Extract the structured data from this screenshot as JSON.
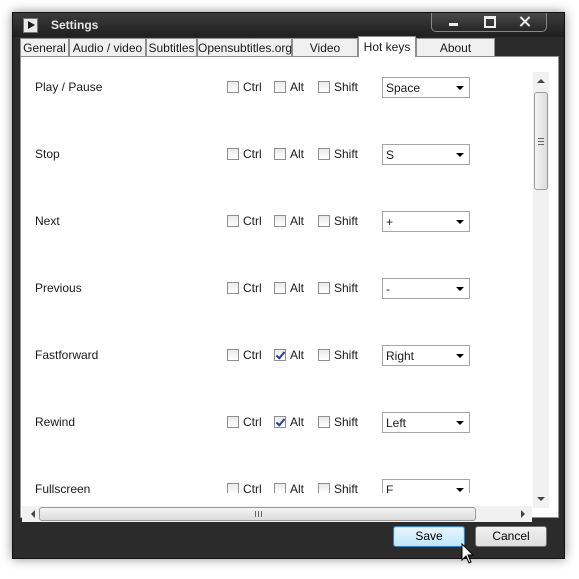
{
  "window": {
    "title": "Settings"
  },
  "tabs": [
    {
      "label": "General"
    },
    {
      "label": "Audio / video"
    },
    {
      "label": "Subtitles"
    },
    {
      "label": "Opensubtitles.org"
    },
    {
      "label": "Video library"
    },
    {
      "label": "Hot keys",
      "active": true
    },
    {
      "label": "About Kantaris"
    }
  ],
  "modifier_labels": {
    "ctrl": "Ctrl",
    "alt": "Alt",
    "shift": "Shift"
  },
  "hotkeys": [
    {
      "action": "Play / Pause",
      "ctrl": false,
      "alt": false,
      "shift": false,
      "key": "Space"
    },
    {
      "action": "Stop",
      "ctrl": false,
      "alt": false,
      "shift": false,
      "key": "S"
    },
    {
      "action": "Next",
      "ctrl": false,
      "alt": false,
      "shift": false,
      "key": "+"
    },
    {
      "action": "Previous",
      "ctrl": false,
      "alt": false,
      "shift": false,
      "key": "-"
    },
    {
      "action": "Fastforward",
      "ctrl": false,
      "alt": true,
      "shift": false,
      "key": "Right"
    },
    {
      "action": "Rewind",
      "ctrl": false,
      "alt": true,
      "shift": false,
      "key": "Left"
    },
    {
      "action": "Fullscreen",
      "ctrl": false,
      "alt": false,
      "shift": false,
      "key": "F"
    }
  ],
  "buttons": {
    "save": "Save",
    "cancel": "Cancel"
  },
  "scrollbars": {
    "vertical_position": 0.0,
    "horizontal_position": 0.0
  },
  "icons": {
    "app": "kantaris-app-icon",
    "minimize": "minimize-icon",
    "maximize": "maximize-icon",
    "close": "close-icon",
    "dropdown": "chevron-down-icon",
    "cursor": "mouse-pointer-icon"
  }
}
